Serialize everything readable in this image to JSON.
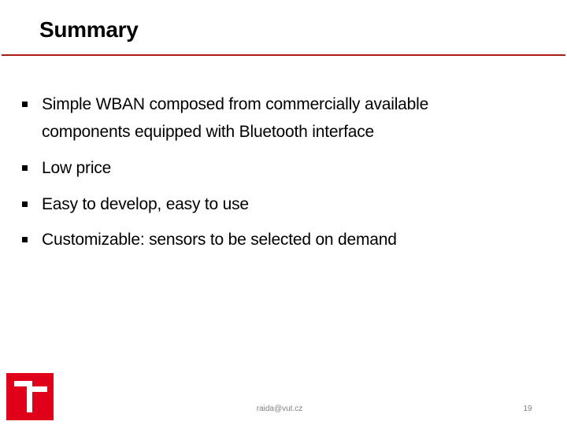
{
  "slide": {
    "title": "Summary",
    "accent_color": "#b01c1c",
    "bullets": [
      {
        "lines": [
          "Simple WBAN composed from commercially available",
          "components equipped with Bluetooth interface"
        ]
      },
      {
        "lines": [
          "Low price"
        ]
      },
      {
        "lines": [
          "Easy to develop, easy to use"
        ]
      },
      {
        "lines": [
          "Customizable: sensors to be selected on demand"
        ]
      }
    ],
    "bullet_icon": "square-bullet-icon"
  },
  "footer": {
    "logo": "vut-logo-icon",
    "logo_color": "#e1001a",
    "email": "raida@vut.cz",
    "page_number": "19"
  }
}
